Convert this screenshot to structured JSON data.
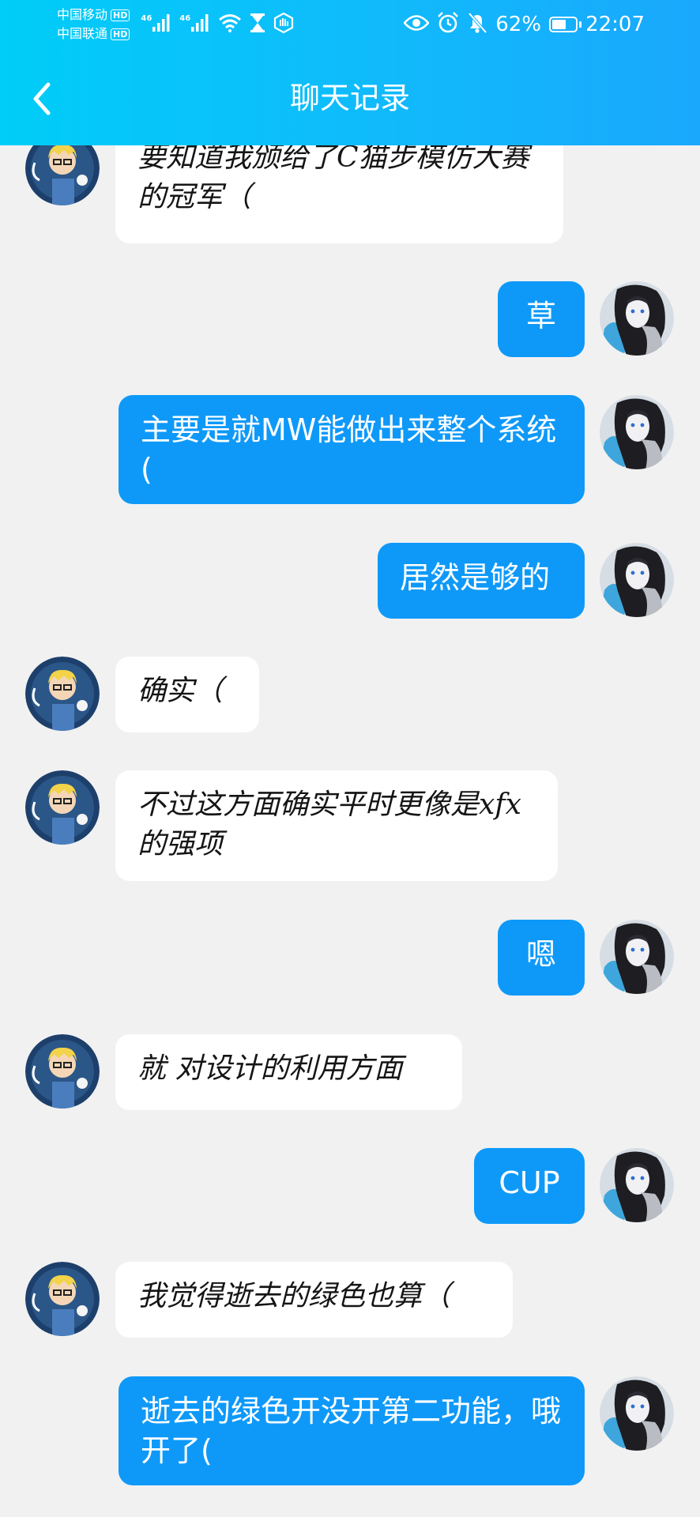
{
  "status_bar": {
    "carrier_1": "中国移动",
    "carrier_2": "中国联通",
    "hd_badge": "HD",
    "signal_tag_1": "46",
    "signal_tag_2": "46",
    "battery_percent": "62%",
    "battery_level": 0.62,
    "time": "22:07",
    "icons": [
      "signal-icon",
      "wifi-icon",
      "hourglass-icon",
      "hand-icon",
      "eye-icon",
      "alarm-icon",
      "mute-bell-icon",
      "battery-icon"
    ]
  },
  "header": {
    "title": "聊天记录",
    "back_icon": "chevron-left-icon"
  },
  "colors": {
    "header_gradient_start": "#00cdf8",
    "header_gradient_end": "#1aa8fc",
    "outgoing_bubble": "#0e99f9",
    "incoming_bubble": "#ffffff",
    "background": "#f1f1f1"
  },
  "messages": [
    {
      "side": "left",
      "text": "要知道我颁给了C猫步模仿大赛的冠军（"
    },
    {
      "side": "right",
      "text": "草"
    },
    {
      "side": "right",
      "text": "主要是就MW能做出来整个系统("
    },
    {
      "side": "right",
      "text": "居然是够的"
    },
    {
      "side": "left",
      "text": "确实（"
    },
    {
      "side": "left",
      "text": "不过这方面确实平时更像是xfx的强项"
    },
    {
      "side": "right",
      "text": "嗯"
    },
    {
      "side": "left",
      "text": "就 对设计的利用方面"
    },
    {
      "side": "right",
      "text": "CUP"
    },
    {
      "side": "left",
      "text": "我觉得逝去的绿色也算（"
    },
    {
      "side": "right",
      "text": "逝去的绿色开没开第二功能，哦开了("
    }
  ]
}
